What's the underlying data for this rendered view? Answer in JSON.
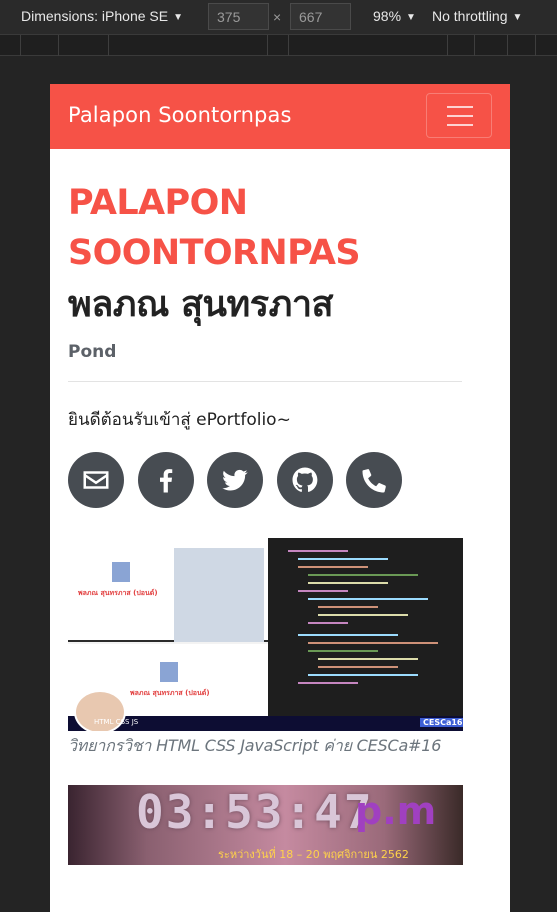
{
  "devtools": {
    "dimensions_label": "Dimensions: iPhone SE",
    "width_value": "375",
    "height_value": "667",
    "zoom": "98%",
    "throttle": "No throttling"
  },
  "navbar": {
    "brand": "Palapon Soontornpas"
  },
  "profile": {
    "name_en_line1": "PALAPON",
    "name_en_line2": "SOONTORNPAS",
    "name_th": "พลภณ สุนทรภาส",
    "nickname": "Pond",
    "welcome": "ยินดีต้อนรับเข้าสู่ ePortfolio~"
  },
  "socials": [
    {
      "name": "envelope-icon"
    },
    {
      "name": "facebook-icon"
    },
    {
      "name": "twitter-icon"
    },
    {
      "name": "github-icon"
    },
    {
      "name": "phone-icon"
    }
  ],
  "portfolio": [
    {
      "caption": "วิทยากรวิชา HTML CSS JavaScript ค่าย CESCa#16",
      "screenshot_title": "พลภณ สุนทรภาส (ปอนด์)",
      "banner_tag": "HTML CSS JS",
      "banner_badge": "CESCa16"
    },
    {
      "clock": "03:53:47",
      "ampm": "p.m",
      "subtitle": "ระหว่างวันที่ 18 – 20 พฤศจิกายน 2562"
    }
  ],
  "colors": {
    "brand": "#f65247",
    "social_bg": "#474c52"
  }
}
